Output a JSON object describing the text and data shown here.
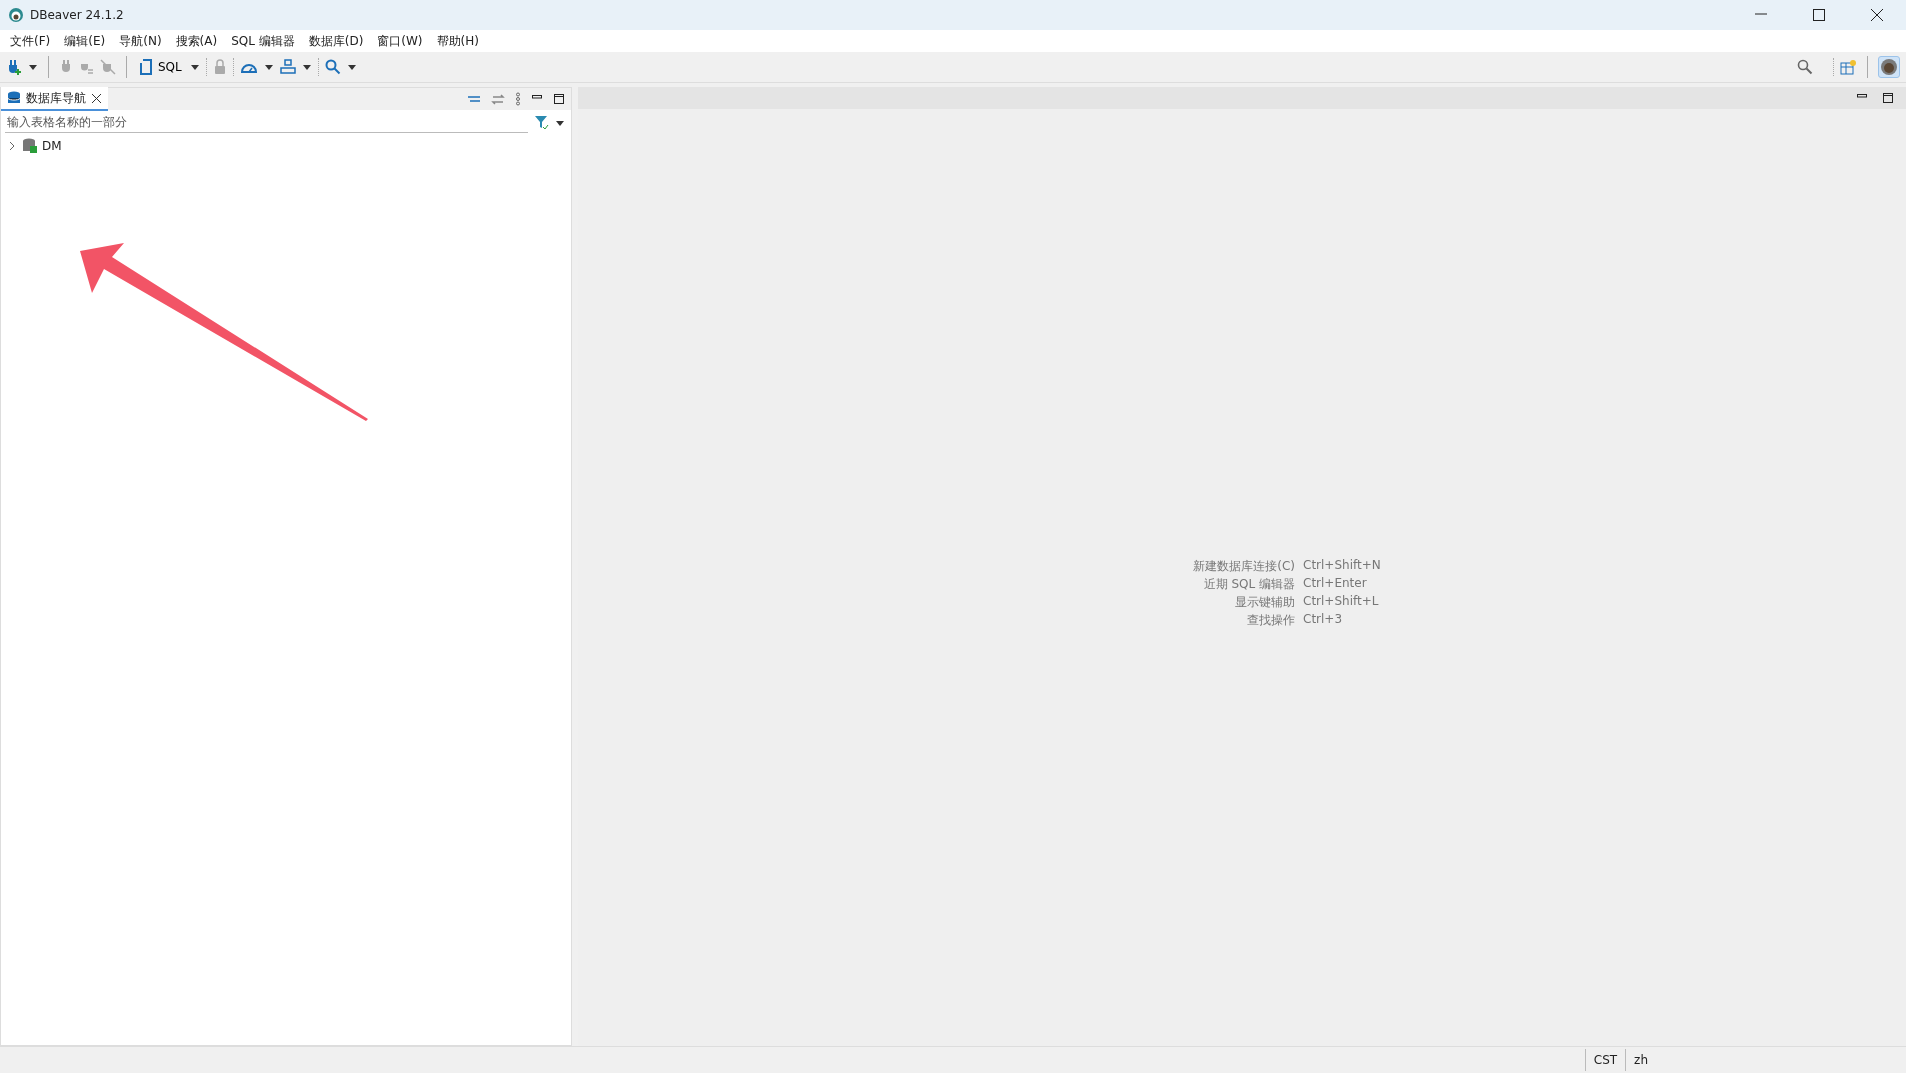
{
  "window": {
    "title": "DBeaver 24.1.2"
  },
  "menu": [
    {
      "label": "文件(F)"
    },
    {
      "label": "编辑(E)"
    },
    {
      "label": "导航(N)"
    },
    {
      "label": "搜索(A)"
    },
    {
      "label": "SQL 编辑器"
    },
    {
      "label": "数据库(D)"
    },
    {
      "label": "窗口(W)"
    },
    {
      "label": "帮助(H)"
    }
  ],
  "toolbar": {
    "sql_label": "SQL"
  },
  "navigator": {
    "tab": {
      "label": "数据库导航",
      "selected": true
    },
    "filter": {
      "placeholder": "输入表格名称的一部分"
    },
    "tree": [
      {
        "label": "DM",
        "expanded": false
      }
    ]
  },
  "shortcuts": [
    {
      "action": "新建数据库连接(C)",
      "keys": "Ctrl+Shift+N"
    },
    {
      "action": "近期 SQL 编辑器",
      "keys": "Ctrl+Enter"
    },
    {
      "action": "显示键辅助",
      "keys": "Ctrl+Shift+L"
    },
    {
      "action": "查找操作",
      "keys": "Ctrl+3"
    }
  ],
  "status_bar": [
    {
      "text": "CST"
    },
    {
      "text": "zh"
    }
  ]
}
